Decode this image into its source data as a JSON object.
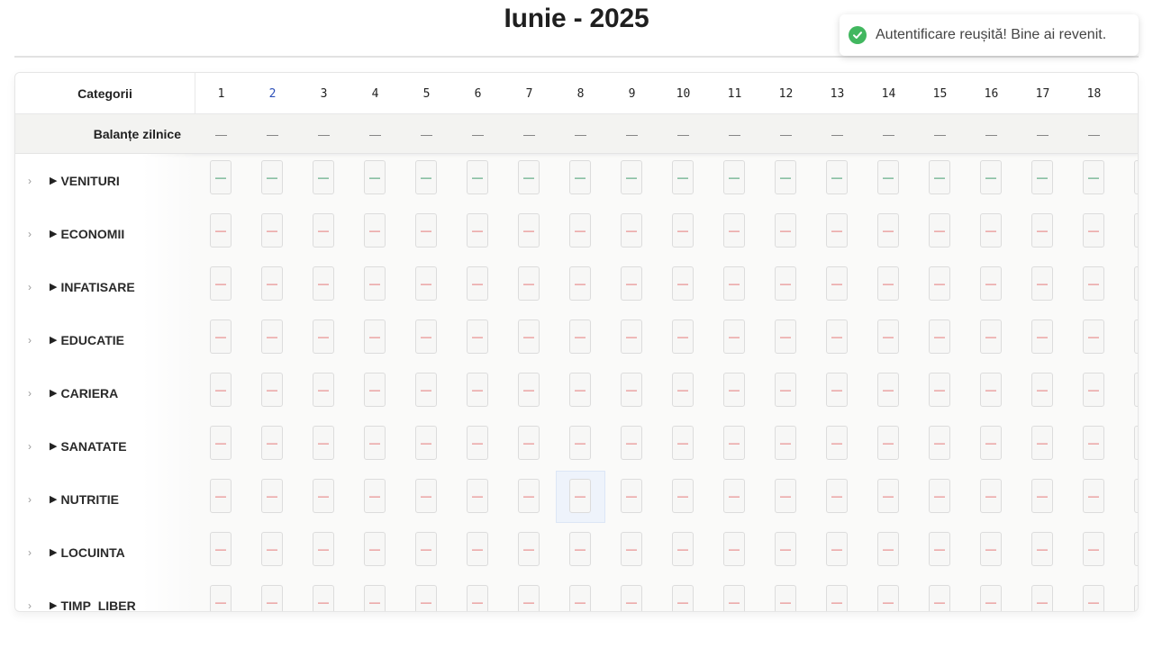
{
  "page": {
    "title": "Iunie - 2025"
  },
  "toast": {
    "icon": "check-circle-icon",
    "message": "Autentificare reușită! Bine ai revenit.",
    "color": "#41b75f"
  },
  "table": {
    "category_header": "Categorii",
    "days": [
      "1",
      "2",
      "3",
      "4",
      "5",
      "6",
      "7",
      "8",
      "9",
      "10",
      "11",
      "12",
      "13",
      "14",
      "15",
      "16",
      "17",
      "18"
    ],
    "today_index": 1,
    "balances": {
      "label": "Balanțe zilnice",
      "placeholder": "—"
    },
    "cell_placeholder": "—",
    "categories": [
      {
        "name": "VENITURI",
        "type": "income"
      },
      {
        "name": "ECONOMII",
        "type": "expense"
      },
      {
        "name": "INFATISARE",
        "type": "expense"
      },
      {
        "name": "EDUCATIE",
        "type": "expense"
      },
      {
        "name": "CARIERA",
        "type": "expense"
      },
      {
        "name": "SANATATE",
        "type": "expense"
      },
      {
        "name": "NUTRITIE",
        "type": "expense"
      },
      {
        "name": "LOCUINTA",
        "type": "expense"
      },
      {
        "name": "TIMP_LIBER",
        "type": "expense"
      }
    ],
    "colors": {
      "income": "#1d8a52",
      "expense": "#e06060",
      "today": "#2c4fb8"
    }
  }
}
